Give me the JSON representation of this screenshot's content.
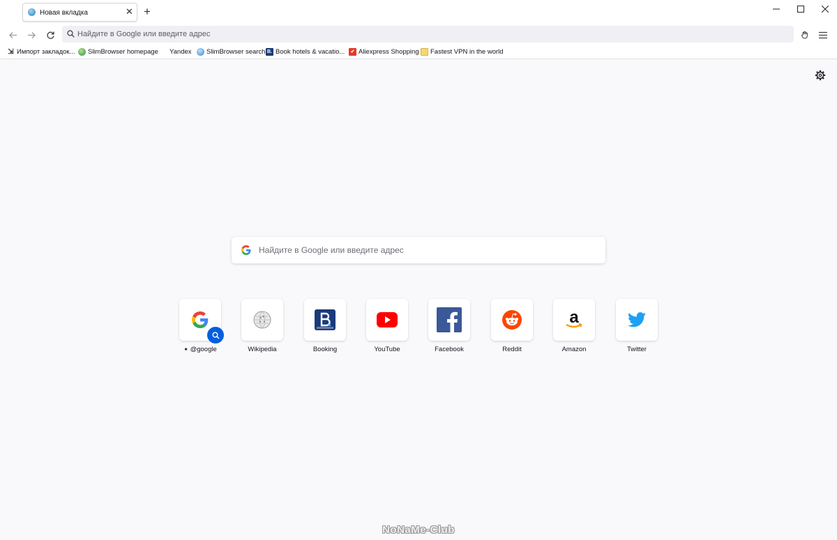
{
  "tabs": [
    {
      "title": "Новая вкладка",
      "icon": "globe-icon"
    }
  ],
  "window_controls": [
    "minimize-icon",
    "maximize-icon",
    "close-icon"
  ],
  "navbar": {
    "url_placeholder": "Найдите в Google или введите адрес"
  },
  "bookmarks": [
    {
      "label": "Импорт закладок...",
      "icon": "import-icon"
    },
    {
      "label": "SlimBrowser homepage",
      "icon": "slimbrowser-icon"
    },
    {
      "label": "Yandex",
      "icon": ""
    },
    {
      "label": "SlimBrowser search",
      "icon": "search-globe-icon"
    },
    {
      "label": "Book hotels & vacatio...",
      "icon": "booking-icon"
    },
    {
      "label": "Aliexpress Shopping",
      "icon": "aliexpress-icon"
    },
    {
      "label": "Fastest VPN in the world",
      "icon": "vpn-icon"
    }
  ],
  "search": {
    "placeholder": "Найдите в Google или введите адрес"
  },
  "tiles": [
    {
      "label": "@google",
      "icon": "google-icon"
    },
    {
      "label": "Wikipedia",
      "icon": "wikipedia-icon"
    },
    {
      "label": "Booking",
      "icon": "booking-icon"
    },
    {
      "label": "YouTube",
      "icon": "youtube-icon"
    },
    {
      "label": "Facebook",
      "icon": "facebook-icon"
    },
    {
      "label": "Reddit",
      "icon": "reddit-icon"
    },
    {
      "label": "Amazon",
      "icon": "amazon-icon"
    },
    {
      "label": "Twitter",
      "icon": "twitter-icon"
    }
  ],
  "watermark": "NoNaMe-Club",
  "colors": {
    "accent": "#0060df",
    "page_bg": "#f9f9fb",
    "urlbar_bg": "#f0f0f4"
  }
}
